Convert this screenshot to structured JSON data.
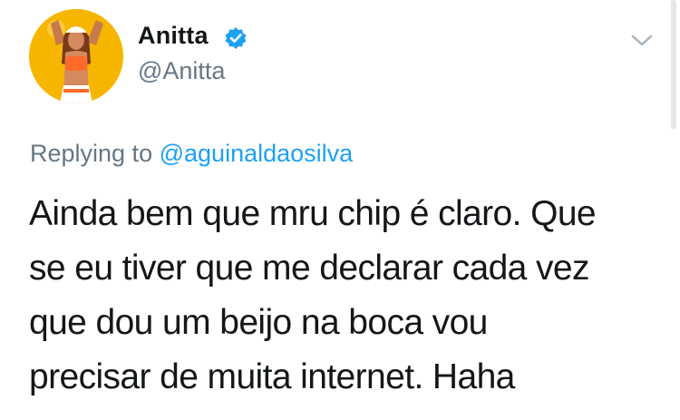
{
  "author": {
    "display_name": "Anitta",
    "handle": "@Anitta",
    "verified": true,
    "avatar_icon": "user-avatar-photo"
  },
  "reply": {
    "prefix": "Replying to",
    "target": "@aguinaldaosilva"
  },
  "tweet": {
    "lines": [
      "Ainda bem que mru chip é claro. Que",
      "se eu tiver que me declarar cada vez",
      "que dou um beijo na boca vou",
      "precisar de muita internet. Haha"
    ]
  },
  "colors": {
    "text": "#14171a",
    "secondary": "#657786",
    "link": "#1da1f2",
    "verified_badge": "#1da1f2",
    "avatar_background": "#f6b600"
  },
  "icons": {
    "verified": "verified-badge-icon",
    "caret": "chevron-down-icon"
  }
}
